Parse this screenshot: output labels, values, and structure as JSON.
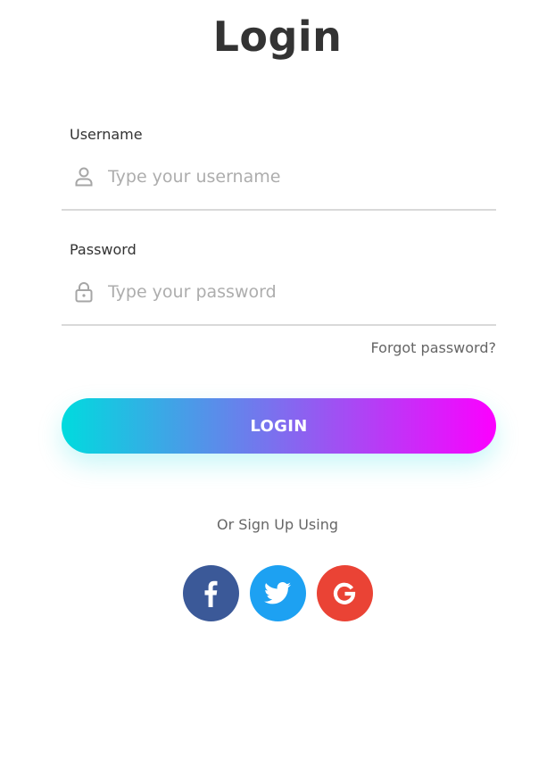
{
  "title": "Login",
  "username": {
    "label": "Username",
    "placeholder": "Type your username",
    "value": "",
    "icon": "user-icon"
  },
  "password": {
    "label": "Password",
    "placeholder": "Type your password",
    "value": "",
    "icon": "lock-icon"
  },
  "forgot_password": "Forgot password?",
  "login_button": "LOGIN",
  "login_gradient": [
    "#00dbde",
    "#fc00ff"
  ],
  "signup_text": "Or Sign Up Using",
  "socials": [
    {
      "name": "facebook",
      "icon": "facebook-icon",
      "color": "#3b5998"
    },
    {
      "name": "twitter",
      "icon": "twitter-icon",
      "color": "#1da1f2"
    },
    {
      "name": "google",
      "icon": "google-icon",
      "color": "#ea4335"
    }
  ]
}
